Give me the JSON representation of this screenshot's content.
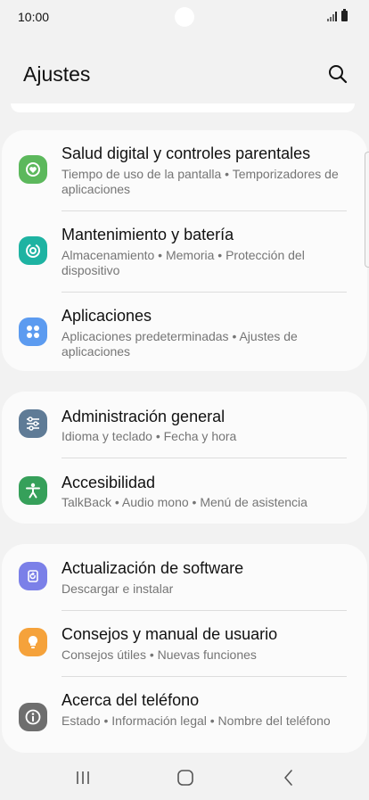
{
  "status_bar": {
    "time": "10:00"
  },
  "header": {
    "title": "Ajustes"
  },
  "groups": [
    {
      "items": [
        {
          "title": "Salud digital y controles parentales",
          "subtitle": "Tiempo de uso de la pantalla  •  Temporizadores de aplicaciones",
          "icon": "digital-wellbeing-icon",
          "color": "#5cb85c"
        },
        {
          "title": "Mantenimiento y batería",
          "subtitle": "Almacenamiento  •  Memoria  •  Protección del dispositivo",
          "icon": "device-care-icon",
          "color": "#1eb3a2"
        },
        {
          "title": "Aplicaciones",
          "subtitle": "Aplicaciones predeterminadas  •  Ajustes de aplicaciones",
          "icon": "apps-icon",
          "color": "#5c9bf0"
        }
      ]
    },
    {
      "items": [
        {
          "title": "Administración general",
          "subtitle": "Idioma y teclado  •  Fecha y hora",
          "icon": "general-management-icon",
          "color": "#5f7b96"
        },
        {
          "title": "Accesibilidad",
          "subtitle": "TalkBack  •  Audio mono  •  Menú de asistencia",
          "icon": "accessibility-icon",
          "color": "#36a05a"
        }
      ]
    },
    {
      "items": [
        {
          "title": "Actualización de software",
          "subtitle": "Descargar e instalar",
          "icon": "software-update-icon",
          "color": "#7b80e8"
        },
        {
          "title": "Consejos y manual de usuario",
          "subtitle": "Consejos útiles  •  Nuevas funciones",
          "icon": "tips-icon",
          "color": "#f5a23b"
        },
        {
          "title": "Acerca del teléfono",
          "subtitle": "Estado  •  Información legal  •  Nombre del teléfono",
          "icon": "about-phone-icon",
          "color": "#6e6e6e"
        }
      ]
    }
  ],
  "nav_bar": {
    "buttons": [
      "recents-icon",
      "home-icon",
      "back-icon"
    ]
  }
}
